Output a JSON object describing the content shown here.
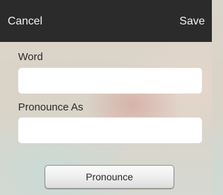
{
  "navbar": {
    "cancel_label": "Cancel",
    "save_label": "Save"
  },
  "form": {
    "word": {
      "label": "Word",
      "value": "",
      "placeholder": ""
    },
    "pronounce_as": {
      "label": "Pronounce As",
      "value": "",
      "placeholder": ""
    },
    "pronounce_button_label": "Pronounce"
  },
  "colors": {
    "navbar_background": "#2b2b2b",
    "navbar_text": "#f2f2f2",
    "field_background": "#ffffff"
  }
}
